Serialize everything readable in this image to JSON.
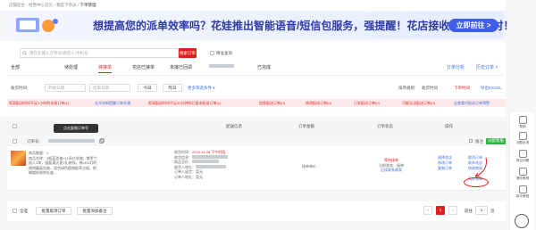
{
  "breadcrumb": {
    "items": [
      "店铺后台",
      "经营中心首页",
      "我是下单员",
      "下单管理"
    ]
  },
  "banner": {
    "text": "想提高您的派单效率吗？花娃推出智能语音/短信包服务，强提醒！花店接收信息更及时！",
    "cta": "立即前往 >"
  },
  "search": {
    "placeholder": "请在此输入订单号/收货人/手机号",
    "button": "搜索订单",
    "checkbox_label": "精准查询"
  },
  "tabs": {
    "items": [
      {
        "label": "全部"
      },
      {
        "label": "待处理"
      },
      {
        "label": "待接单"
      },
      {
        "label": "花店已接单"
      },
      {
        "label": "未接已回调"
      },
      {
        "label": "已完成"
      }
    ],
    "right": [
      "订单分析",
      "历史订单 >"
    ]
  },
  "filters": {
    "received_label": "收货时间:",
    "start_placeholder": "开始日期",
    "end_placeholder": "结束日期",
    "today": "今日",
    "yesterday": "昨日",
    "more": "更多筛选条件 ▾",
    "sort_label": "排序规则:",
    "sort_value": "收货时间",
    "order_value": "下单时间",
    "export": "导出EXCEL"
  },
  "alerts": [
    "距离配送时间不足1小时的未接订单(1)",
    "去开启新提醒订单开通",
    "距离配送时间不足40分钟的已接未配送订单(1)",
    "加急配送订单(0)",
    "修改配送订单(0)",
    "已发配送订单(0)",
    "可能无法配送订单(0)",
    "去查看代配送订单预警"
  ],
  "table": {
    "headers": [
      "订单号",
      "配送信息",
      "订单金额",
      "订单状态",
      "操作"
    ],
    "tooltip": "点击复制订单号",
    "order_label": "订单号:",
    "order_actions": [
      "备注",
      "分配客服"
    ]
  },
  "order": {
    "product_title": "商品数量：1",
    "product_name": "商品名称：3瓶蓝玫瑰+11朵红玫瑰，紫罗兰插入3束，搭配满天星1扎装饰，带LED灯的透明蘑菇包装，混合绿色植物配草点缀，附蝴蝶结装饰礼盒...",
    "delivery_time_label": "收货时间：",
    "delivery_time": "2024-11-08 下午时段",
    "recipient_label": "收货信息：",
    "product_label": "商品总价：",
    "receiver_label": "收货人地址：",
    "amount": "接单单价",
    "status": "等待接单",
    "status_sub": "当前状态：接单",
    "status_link": "后续联系商家",
    "ops": [
      "选择花店",
      "修改订单",
      "修改商家",
      "取消订单",
      "退款",
      "联系花店",
      "复制订单",
      "再次派单"
    ],
    "note1": "订单人留言：暂无",
    "note2": "订单人地址：暂无"
  },
  "footer": {
    "select_all": "全选",
    "batch_cancel": "批量取消订单",
    "batch_add": "批量添加备注",
    "page": "1",
    "goto": "前往",
    "page_unit": "页"
  },
  "sidebar": {
    "items": [
      {
        "label": "帮助"
      },
      {
        "label": "问题反馈"
      },
      {
        "label": "常见问题"
      },
      {
        "label": "操作教程"
      },
      {
        "label": "新手教程"
      }
    ]
  }
}
